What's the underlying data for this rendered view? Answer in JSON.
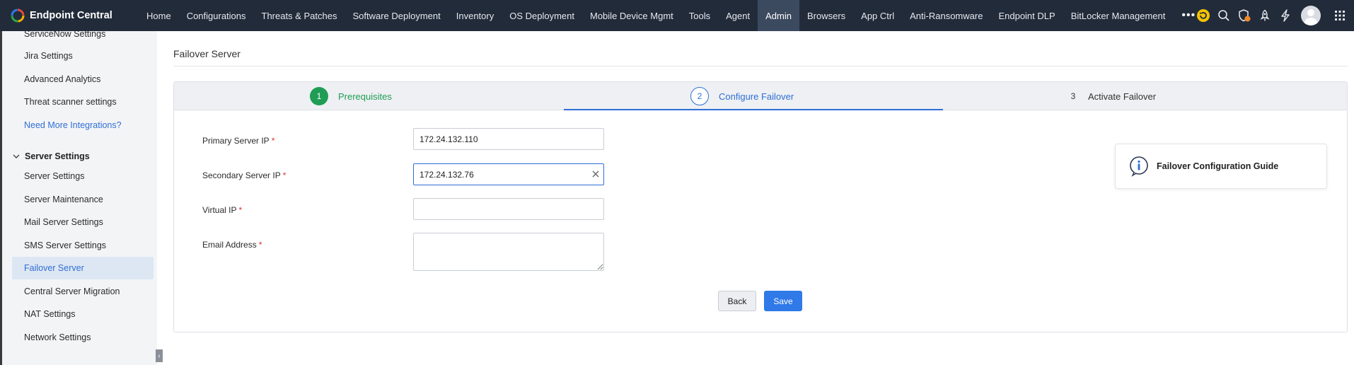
{
  "app": {
    "brand_name": "Endpoint Central"
  },
  "topnav": {
    "items": [
      {
        "label": "Home"
      },
      {
        "label": "Configurations"
      },
      {
        "label": "Threats & Patches"
      },
      {
        "label": "Software Deployment"
      },
      {
        "label": "Inventory"
      },
      {
        "label": "OS Deployment"
      },
      {
        "label": "Mobile Device Mgmt"
      },
      {
        "label": "Tools"
      },
      {
        "label": "Agent"
      },
      {
        "label": "Admin",
        "active": true
      },
      {
        "label": "Browsers"
      },
      {
        "label": "App Ctrl"
      },
      {
        "label": "Anti-Ransomware"
      },
      {
        "label": "Endpoint DLP"
      },
      {
        "label": "BitLocker Management"
      }
    ],
    "more_label": "•••",
    "icons": [
      "refresh-status-icon",
      "search-icon",
      "shield-alert-icon",
      "rocket-icon",
      "lightning-icon",
      "user-avatar",
      "app-grid-icon"
    ]
  },
  "sidebar": {
    "items_top": [
      {
        "label": "ServiceNow Settings"
      },
      {
        "label": "Jira Settings"
      },
      {
        "label": "Advanced Analytics"
      },
      {
        "label": "Threat scanner settings"
      },
      {
        "label": "Need More Integrations?",
        "link": true
      }
    ],
    "section_label": "Server Settings",
    "section_items": [
      {
        "label": "Server Settings"
      },
      {
        "label": "Server Maintenance"
      },
      {
        "label": "Mail Server Settings"
      },
      {
        "label": "SMS Server Settings"
      },
      {
        "label": "Failover Server",
        "active": true
      },
      {
        "label": "Central Server Migration"
      },
      {
        "label": "NAT Settings"
      },
      {
        "label": "Network Settings"
      }
    ]
  },
  "page": {
    "title": "Failover Server"
  },
  "wizard": {
    "steps": [
      {
        "number": "1",
        "label": "Prerequisites",
        "state": "done"
      },
      {
        "number": "2",
        "label": "Configure Failover",
        "state": "current"
      },
      {
        "number": "3",
        "label": "Activate Failover",
        "state": "pending"
      }
    ]
  },
  "form": {
    "primary_ip_label": "Primary Server IP",
    "primary_ip_value": "172.24.132.110",
    "secondary_ip_label": "Secondary Server IP",
    "secondary_ip_value": "172.24.132.76",
    "virtual_ip_label": "Virtual IP",
    "virtual_ip_value": "",
    "email_label": "Email Address",
    "email_value": "",
    "required_mark": "*",
    "back_label": "Back",
    "save_label": "Save"
  },
  "guide": {
    "label": "Failover Configuration Guide"
  },
  "colors": {
    "topbar_bg": "#222b3a",
    "accent_blue": "#2f6fd6",
    "success_green": "#1f9d55",
    "required_red": "#e0312a"
  }
}
